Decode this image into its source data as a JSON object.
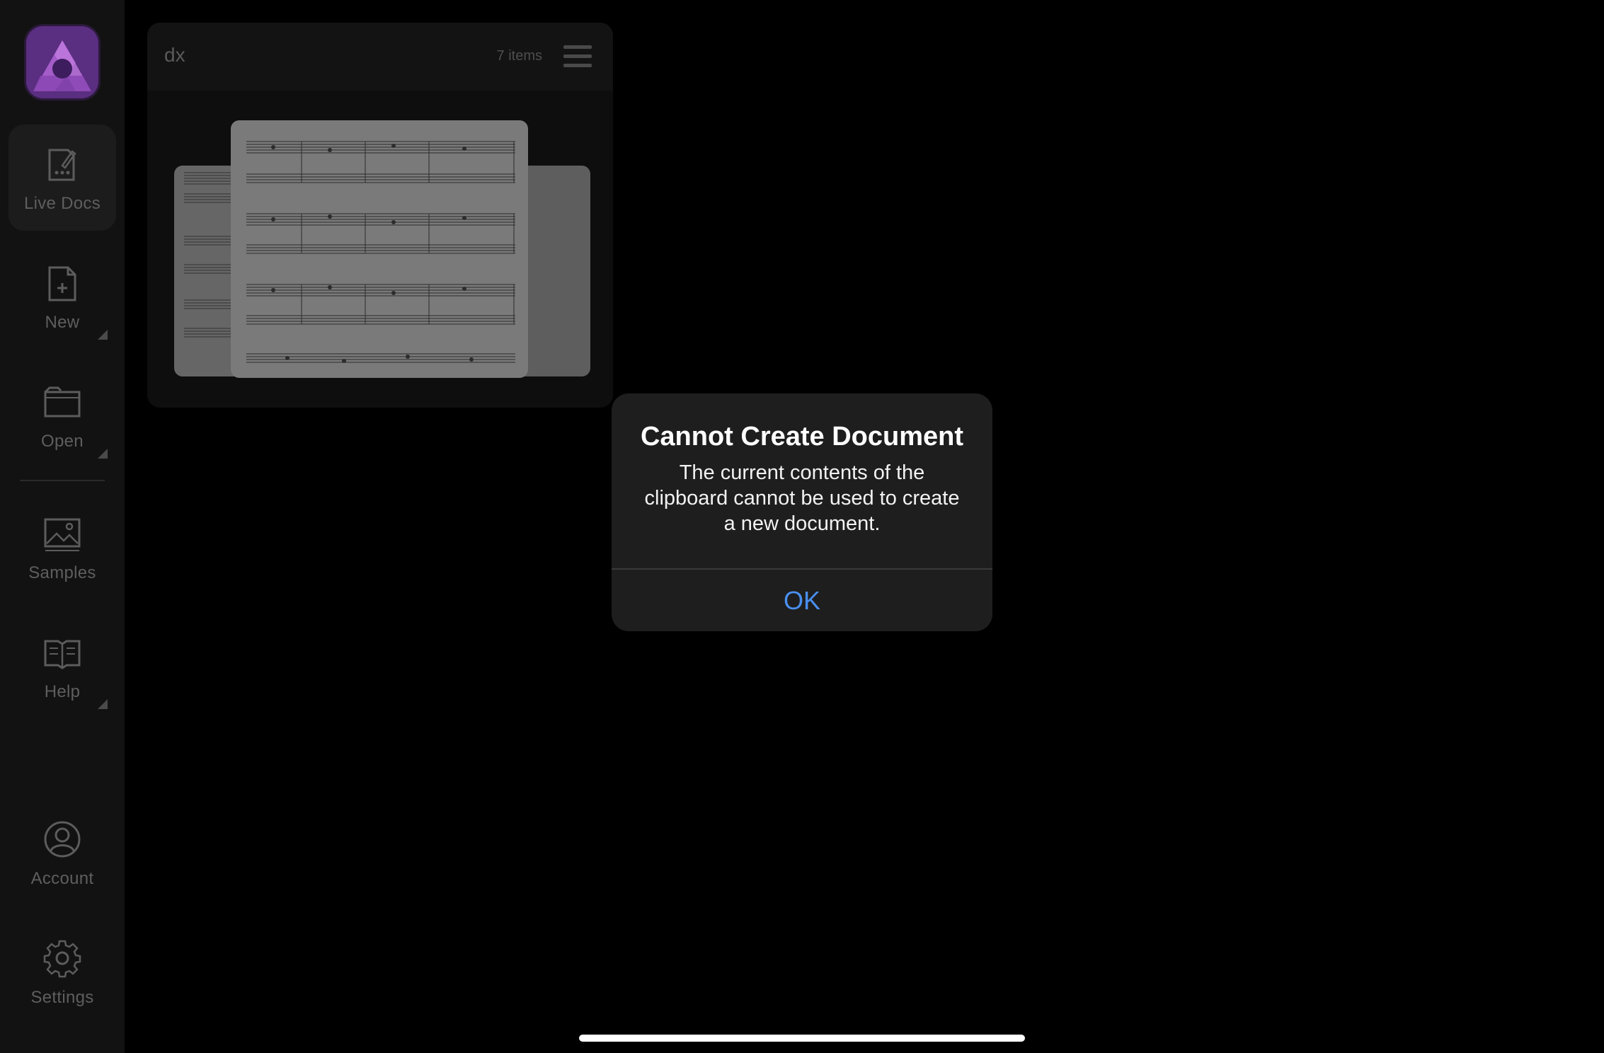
{
  "sidebar": {
    "logo_icon": "affinity-photo-logo-icon",
    "items": [
      {
        "label": "Live Docs",
        "icon": "live-docs-icon",
        "active": true
      },
      {
        "label": "New",
        "icon": "new-document-icon"
      },
      {
        "label": "Open",
        "icon": "folder-icon"
      },
      {
        "label": "Samples",
        "icon": "image-icon"
      },
      {
        "label": "Help",
        "icon": "book-icon"
      },
      {
        "label": "Account",
        "icon": "account-icon"
      },
      {
        "label": "Settings",
        "icon": "gear-icon"
      }
    ]
  },
  "document_group": {
    "title": "dx",
    "count": "7 items",
    "menu_icon": "hamburger-menu-icon"
  },
  "alert": {
    "title": "Cannot Create Document",
    "message": "The current contents of the clipboard cannot be used to create a new document.",
    "ok_label": "OK"
  },
  "colors": {
    "accent": "#4a8ff0",
    "logo_purple": "#7a3fa0",
    "background": "#000000"
  }
}
